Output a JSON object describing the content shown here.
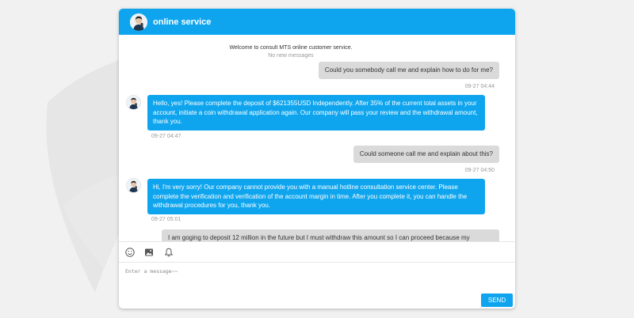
{
  "header": {
    "title": "online service"
  },
  "system": {
    "welcome": "Welcome to consult MTS online customer service.",
    "no_new_messages": "No new messages"
  },
  "messages": [
    {
      "from": "user",
      "text": "Could you somebody call me and explain how to do for me?",
      "time": "09-27 04:44"
    },
    {
      "from": "agent",
      "text": "Hello, yes! Please complete the deposit of $621355USD Independently. After 35% of the current total assets in your account, initiate a coin withdrawal application again. Our company will pass your review and the withdrawal amount, thank you.",
      "time": "09-27 04:47"
    },
    {
      "from": "user",
      "text": "Could someone call me and explain about this?",
      "time": "09-27 04:50"
    },
    {
      "from": "agent",
      "text": "Hi, I'm very sorry! Our company cannot provide you with a manual hotline consultation service center. Please complete the verification and verification of the account margin in time. After you complete it, you can handle the withdrawal procedures for you, thank you.",
      "time": "09-27 05:01"
    },
    {
      "from": "user",
      "text": "I am goging to deposit 12 million in the future but I must withdraw this amount so I can proceed because my"
    }
  ],
  "toolbar": {
    "icons": [
      "emoji-icon",
      "image-icon",
      "bell-icon"
    ]
  },
  "composer": {
    "placeholder": "Enter a message~~",
    "send_label": "SEND"
  },
  "colors": {
    "accent": "#0ea5ee",
    "user_bubble": "#dadada",
    "background": "#f1f1f1"
  }
}
